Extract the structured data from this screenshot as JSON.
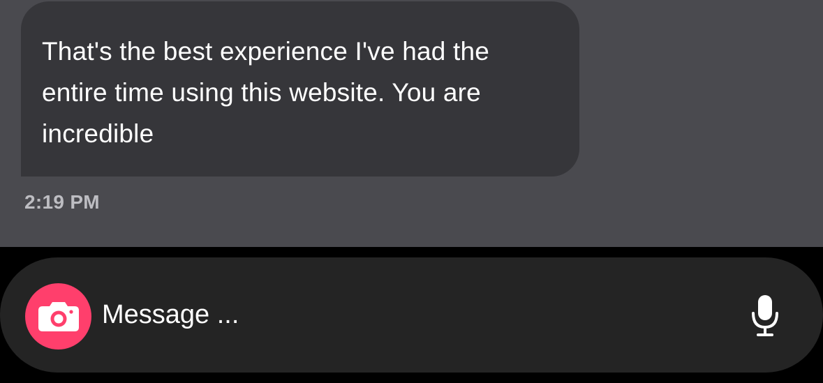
{
  "message": {
    "text": "That's the best experience I've had the entire time using this website. You are incredible",
    "timestamp": "2:19 PM"
  },
  "composer": {
    "placeholder": "Message ...",
    "camera_icon": "camera-icon",
    "mic_icon": "microphone-icon",
    "accent_color": "#ff3f6c"
  },
  "colors": {
    "chat_background": "#4a4a4f",
    "bubble_background": "#36363a",
    "composer_background": "#242424"
  }
}
